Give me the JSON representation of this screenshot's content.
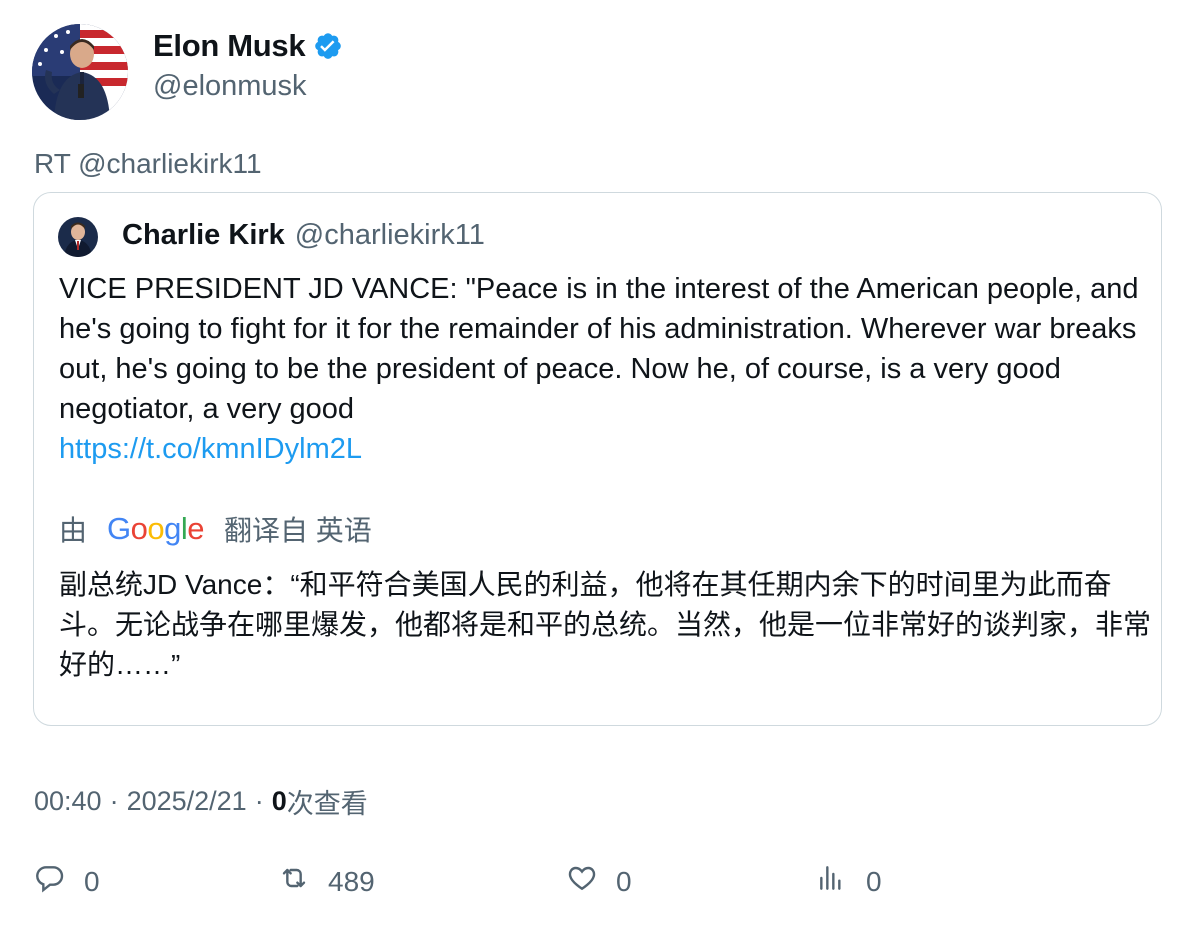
{
  "author": {
    "name": "Elon Musk",
    "handle": "@elonmusk",
    "verified_color": "#1d9bf0"
  },
  "retweet_line": "RT @charliekirk11",
  "quote": {
    "name": "Charlie Kirk",
    "handle": "@charliekirk11",
    "text": "VICE PRESIDENT JD VANCE: \"Peace is in the interest of the American people, and he's going to fight for it for the remainder of his administration. Wherever war breaks out, he's going to be the president of peace. Now he, of course, is a very good negotiator, a very good",
    "link": "https://t.co/kmnIDylm2L",
    "translate_by": "由",
    "translate_brand": "Google",
    "translate_from": "翻译自 英语",
    "translated_text": "副总统JD Vance：“和平符合美国人民的利益，他将在其任期内余下的时间里为此而奋斗。无论战争在哪里爆发，他都将是和平的总统。当然，他是一位非常好的谈判家，非常好的……”"
  },
  "meta": {
    "time": "00:40",
    "separator": "·",
    "date": "2025/2/21",
    "views_count": "0",
    "views_label": "次查看"
  },
  "actions": {
    "reply_count": "0",
    "retweet_count": "489",
    "like_count": "0",
    "views_count": "0"
  },
  "icons": {
    "verified": "verified-badge-icon",
    "reply": "reply-icon",
    "retweet": "retweet-icon",
    "like": "heart-icon",
    "views": "views-chart-icon"
  },
  "colors": {
    "text": "#0f1419",
    "secondary": "#536471",
    "link": "#1d9bf0",
    "border": "#cfd9de"
  }
}
